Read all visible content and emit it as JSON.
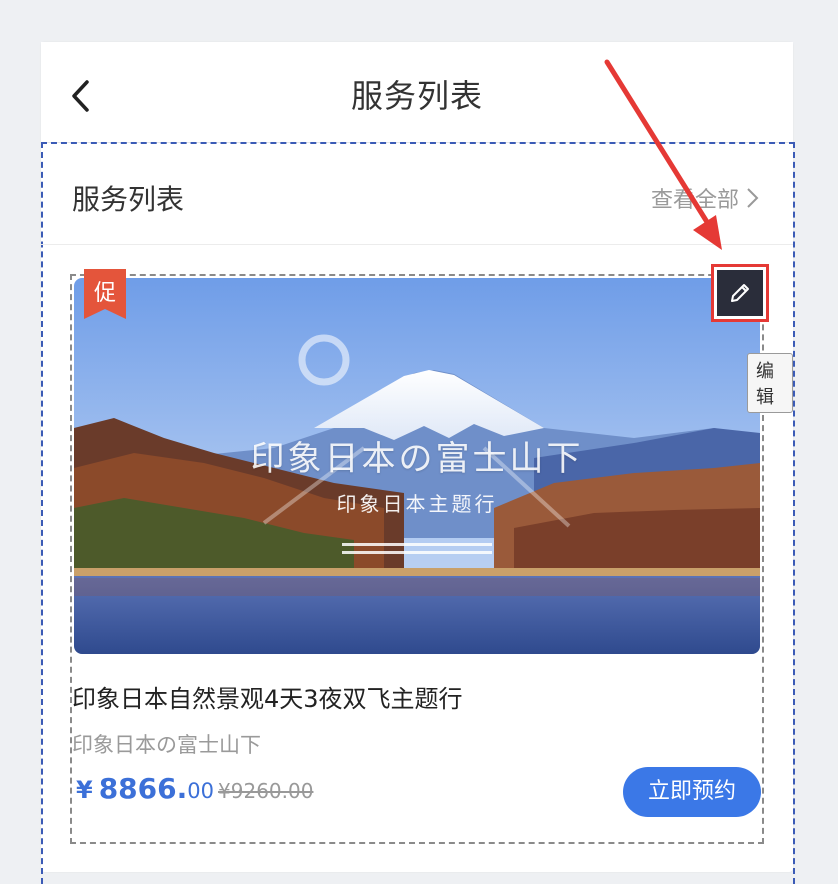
{
  "header": {
    "title": "服务列表"
  },
  "section": {
    "title": "服务列表",
    "more_label": "查看全部"
  },
  "card": {
    "promo_badge": "促",
    "banner_title": "印象日本の富士山下",
    "banner_subtitle": "印象日本主题行",
    "product_title": "印象日本自然景观4天3夜双飞主题行",
    "product_subtitle": "印象日本の富士山下",
    "price_symbol": "¥",
    "price_main": "8866.",
    "price_decimal": "00",
    "price_original": "¥9260.00",
    "book_label": "立即预约"
  },
  "edit_tooltip": "编辑",
  "icons": {
    "back": "chevron-left-icon",
    "more": "chevron-right-icon",
    "edit": "pencil-icon"
  },
  "colors": {
    "accent": "#3b78e7",
    "price": "#3c70d8",
    "promo": "#e4553b",
    "highlight": "#e53935",
    "outline": "#3b5bb6"
  }
}
